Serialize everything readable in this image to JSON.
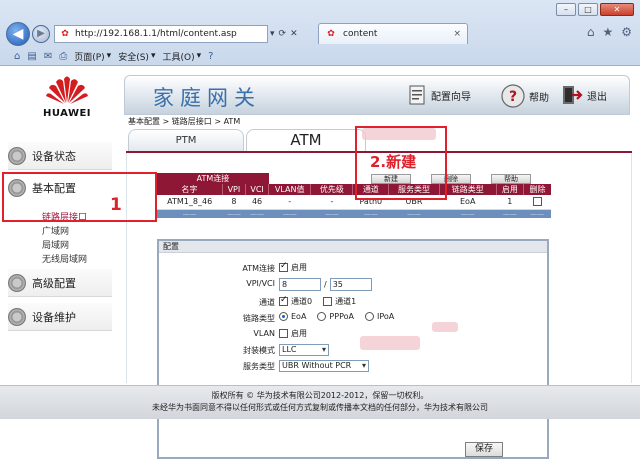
{
  "browser": {
    "window_buttons": [
      "–",
      "□",
      "✕"
    ],
    "url": "http://192.168.1.1/html/content.asp",
    "tab_title": "content",
    "tab_close": "×",
    "nav_back": "◀",
    "nav_forward": "▶",
    "address_tools": [
      "▾",
      "⟳",
      "✕"
    ],
    "command_menus": [
      {
        "label": "页面(P)"
      },
      {
        "label": "安全(S)"
      },
      {
        "label": "工具(O)"
      }
    ],
    "right_icons": [
      "⌂",
      "★",
      "⚙"
    ]
  },
  "router": {
    "brand": "HUAWEI",
    "title": "家庭网关",
    "config_wizard": "配置向导",
    "help": "帮助",
    "logout": "退出",
    "breadcrumb": "基本配置 > 链路层接口 > ATM",
    "sidebar": {
      "device_status": "设备状态",
      "basic_config": "基本配置",
      "basic_sub": [
        "链路层接口",
        "广域网",
        "局域网",
        "无线局域网"
      ],
      "advanced_config": "高级配置",
      "maintenance": "设备维护"
    },
    "tabs": [
      "PTM",
      "ATM"
    ],
    "atm_section_label": "ATM连接",
    "actions": {
      "new": "新建",
      "delete": "删除",
      "help": "帮助"
    },
    "table": {
      "headers": [
        "名字",
        "VPI",
        "VCI",
        "VLAN值",
        "优先级",
        "通道",
        "服务类型",
        "链路类型",
        "启用",
        "删除"
      ],
      "rows": [
        [
          "ATM1_8_46",
          "8",
          "46",
          "-",
          "-",
          "Path0",
          "UBR",
          "EoA",
          "1",
          ""
        ]
      ],
      "stripe_marks": [
        "——",
        "——",
        "——",
        "——",
        "——",
        "——",
        "——",
        "——",
        "——",
        "——"
      ]
    },
    "config": {
      "section_title": "配置",
      "atm_connection_label": "ATM连接",
      "enable_label": "启用",
      "vpivci_label": "VPI/VCI",
      "vpi": "8",
      "vci": "35",
      "channel_label": "通道",
      "channel0": "通道0",
      "channel1": "通道1",
      "link_type_label": "链路类型",
      "link_types": [
        "EoA",
        "PPPoA",
        "IPoA"
      ],
      "vlan_label": "VLAN",
      "vlan_enable": "启用",
      "encap_label": "封装模式",
      "encap_value": "LLC",
      "service_label": "服务类型",
      "service_value": "UBR Without PCR",
      "save": "保存"
    },
    "footer": {
      "line1": "版权所有 © 华为技术有限公司2012-2012，保留一切权利。",
      "line2": "未经华为书面同意不得以任何形式或任何方式复制或传播本文档的任何部分，华为技术有限公司"
    }
  },
  "annotations": {
    "step1": "1",
    "step2": "2.新建",
    "color": "#e0202a"
  },
  "colors": {
    "accent": "#8e1736",
    "title_blue": "#3b6fa8",
    "stripe_blue": "#6c8fbe"
  }
}
